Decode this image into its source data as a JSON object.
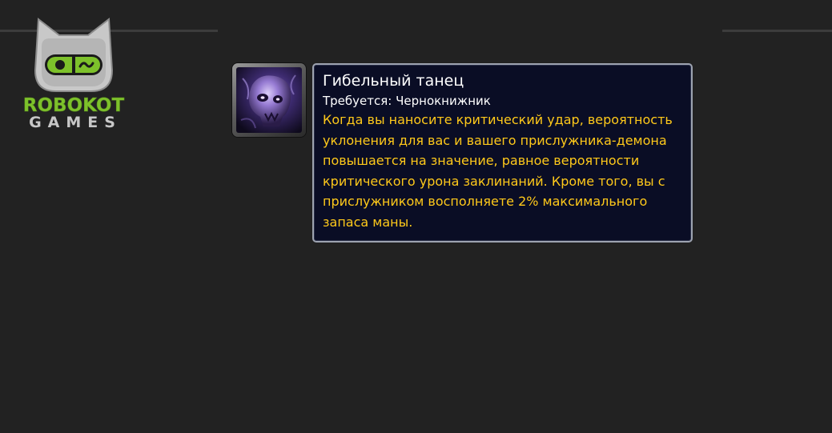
{
  "logo": {
    "line1": "ROBOKOT",
    "line2": "GAMES",
    "icon": "robot-cat-head-icon"
  },
  "spell": {
    "icon": "demon-skull-spell-icon",
    "title": "Гибельный танец",
    "requirement": "Требуется: Чернокнижник",
    "description": "Когда вы наносите критический удар, вероятность уклонения для вас и вашего прислужника-демона повышается на значение, равное вероятности критического урона заклинаний. Кроме того, вы с прислужником восполняете 2% максимального запаса маны."
  },
  "colors": {
    "background": "#222222",
    "tooltip_bg": "#0a0d25",
    "description_text": "#ffc91a",
    "logo_green": "#7dc12b"
  }
}
